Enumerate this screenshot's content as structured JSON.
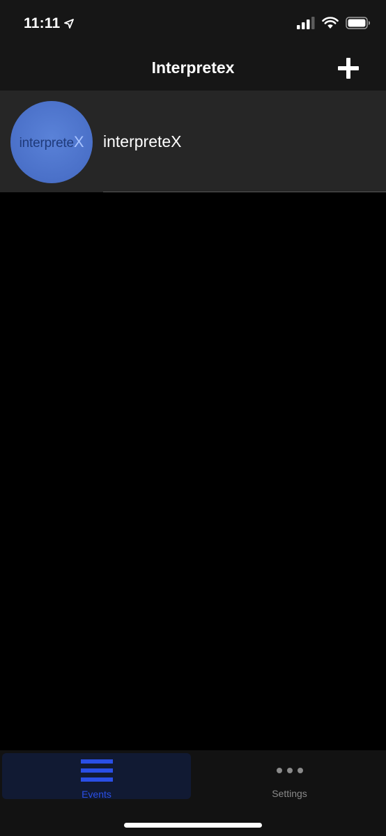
{
  "status_bar": {
    "time": "11:11",
    "location_icon": "location-arrow-icon",
    "signal_icon": "cellular-signal-icon",
    "wifi_icon": "wifi-icon",
    "battery_icon": "battery-icon"
  },
  "nav": {
    "title": "Interpretex",
    "add_icon": "plus-icon"
  },
  "events": [
    {
      "title": "interpreteX",
      "logo_text_main": "interprete",
      "logo_text_x": "X"
    }
  ],
  "tabs": [
    {
      "label": "Events",
      "icon": "hamburger-menu-icon",
      "selected": true
    },
    {
      "label": "Settings",
      "icon": "more-dots-icon",
      "selected": false
    }
  ],
  "colors": {
    "accent": "#2a4fe6",
    "background": "#000000",
    "bar": "#161616",
    "row": "#262626",
    "inactive": "#8a8a8a"
  }
}
